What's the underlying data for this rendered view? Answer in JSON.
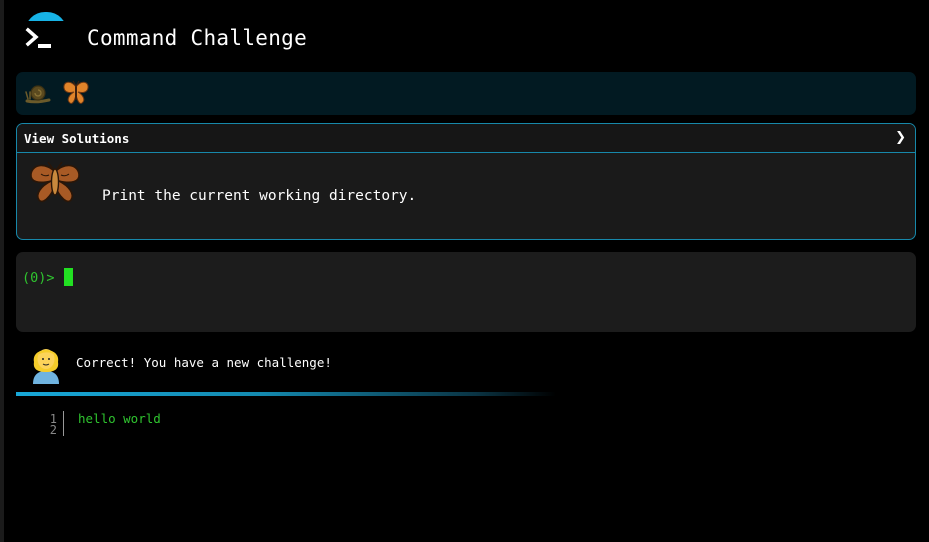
{
  "header": {
    "title": "Command Challenge",
    "logo_icon": "terminal-prompt-icon"
  },
  "emoji_strip": {
    "icons": [
      "snail-icon",
      "butterfly-icon"
    ]
  },
  "challenge": {
    "toggle_label": "View Solutions",
    "toggle_icon": "chevron-right-icon",
    "icon": "moth-icon",
    "description": "Print the current working directory."
  },
  "terminal": {
    "prompt": "(0)>",
    "input_value": ""
  },
  "feedback": {
    "avatar_icon": "woman-blond-hair-icon",
    "message": "Correct! You have a new challenge!"
  },
  "output": {
    "line_numbers": [
      "1",
      "2"
    ],
    "lines": [
      "hello world",
      ""
    ]
  },
  "colors": {
    "accent": "#17b3e6",
    "prompt_green": "#2fc42f",
    "cursor_green": "#22e022",
    "card_border": "#1788aa",
    "panel_bg": "#1c1c1c",
    "strip_bg": "#021a22"
  }
}
